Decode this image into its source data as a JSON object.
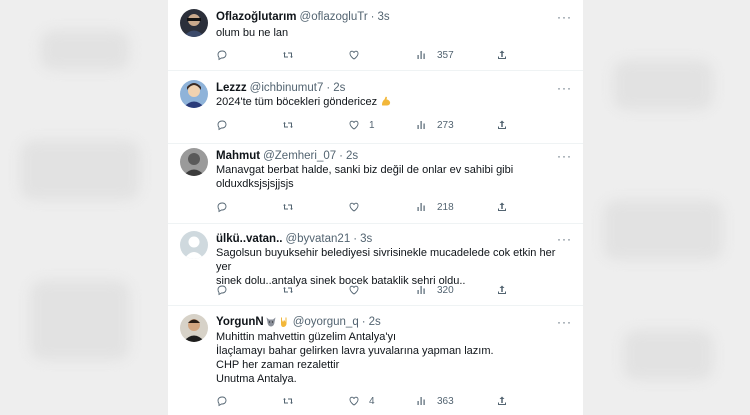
{
  "tweets": [
    {
      "name": "Oflazoğlutarım",
      "handle": "@oflazogluTr",
      "time": "3s",
      "lines": [
        "olum bu ne lan"
      ],
      "counts": {
        "reply": "",
        "retweet": "",
        "like": "",
        "views": "357"
      }
    },
    {
      "name": "Lezzz",
      "handle": "@ichbinumut7",
      "time": "2s",
      "lines": [
        "2024'te tüm böcekleri göndericez"
      ],
      "emoji": "flexed-biceps",
      "counts": {
        "reply": "",
        "retweet": "",
        "like": "1",
        "views": "273"
      }
    },
    {
      "name": "Mahmut",
      "handle": "@Zemheri_07",
      "time": "2s",
      "lines": [
        "Manavgat berbat halde, sanki biz değil de onlar ev sahibi gibi",
        "olduxdksjsjsjjsjs"
      ],
      "counts": {
        "reply": "",
        "retweet": "",
        "like": "",
        "views": "218"
      }
    },
    {
      "name": "ülkü..vatan..",
      "handle": "@byvatan21",
      "time": "3s",
      "lines": [
        "Sagolsun buyuksehir belediyesi sivrisinekle mucadelede cok etkin her yer",
        "sinek dolu..antalya sinek bocek bataklik sehri oldu.."
      ],
      "counts": {
        "reply": "",
        "retweet": "",
        "like": "",
        "views": "320"
      }
    },
    {
      "name": "YorgunN",
      "name_emojis": [
        "wolf-icon",
        "horns-hand-icon"
      ],
      "handle": "@oyorgun_q",
      "time": "2s",
      "lines": [
        "Muhittin mahvettin güzelim Antalya'yı",
        "İlaçlamayı bahar gelirken lavra yuvalarına yapman lazım.",
        "CHP her zaman rezalettir",
        "Unutma Antalya."
      ],
      "counts": {
        "reply": "",
        "retweet": "",
        "like": "4",
        "views": "363"
      }
    }
  ],
  "separator": "·",
  "more": "···",
  "icons": {
    "reply": "reply-icon",
    "retweet": "retweet-icon",
    "like": "like-icon",
    "views": "views-icon",
    "share": "share-icon"
  },
  "colors": {
    "text": "#0f1419",
    "muted": "#536471",
    "divider": "#eff3f4",
    "background": "#ffffff"
  }
}
